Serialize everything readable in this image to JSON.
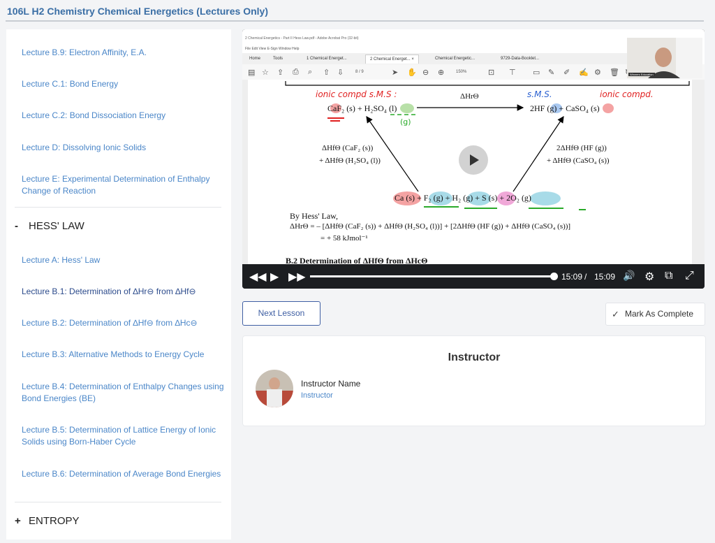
{
  "course": {
    "title": "106L H2 Chemistry Chemical Energetics (Lectures Only)"
  },
  "sidebar": {
    "items_top": [
      {
        "label": "Lecture B.9: Electron Affinity, E.A."
      },
      {
        "label": "Lecture C.1: Bond Energy"
      },
      {
        "label": "Lecture C.2: Bond Dissociation Energy"
      },
      {
        "label": "Lecture D: Dissolving Ionic Solids"
      },
      {
        "label": "Lecture E: Experimental Determination of Enthalpy Change of Reaction"
      }
    ],
    "section_hess": {
      "sign": "-",
      "title": "HESS' LAW"
    },
    "items_hess": [
      {
        "label": "Lecture A: Hess' Law"
      },
      {
        "label": "Lecture B.1: Determination of ∆Hr⊖ from ∆Hf⊖",
        "active": true
      },
      {
        "label": "Lecture B.2: Determination of ∆Hf⊖ from ∆Hc⊖"
      },
      {
        "label": "Lecture B.3: Alternative Methods to Energy Cycle"
      },
      {
        "label": "Lecture B.4: Determination of Enthalpy Changes using Bond Energies (BE)"
      },
      {
        "label": "Lecture B.5: Determination of Lattice Energy of Ionic Solids using Born-Haber Cycle"
      },
      {
        "label": "Lecture B.6: Determination of Average Bond Energies"
      }
    ],
    "section_entropy": {
      "sign": "+",
      "title": "ENTROPY"
    }
  },
  "video": {
    "window_title": "2 Chemical Energetics - Part II Hess Law.pdf - Adobe Acrobat Pro (32-bit)",
    "menu": "File  Edit  View  E-Sign  Window  Help",
    "tabs": [
      "Home",
      "Tools",
      "1 Chemical Energet...",
      "2 Chemical Energet... ×",
      "Chemical Energetic...",
      "9729-Data-Booklet..."
    ],
    "page": "8 / 9",
    "zoom": "150%",
    "webcam_label": "Winners Education",
    "doc": {
      "annot_left": "ionic compd  s.M.S :",
      "annot_right_sms": "s.M.S.",
      "annot_right_ionic": "ionic compd.",
      "arrow_label": "ΔHrΘ",
      "reactants": "CaF₂ (s) + H₂SO₄ (l)",
      "products": "2HF (g) + CaSO₄ (s)",
      "annot_g": "(g)",
      "left_path": [
        "ΔHfΘ (CaF₂ (s))",
        "+ ΔHfΘ (H₂SO₄ (l))"
      ],
      "right_path": [
        "2ΔHfΘ (HF (g))",
        "+ ΔHfΘ (CaSO₄ (s))"
      ],
      "elements": "Ca (s) + F₂ (g) + H₂ (g) + S (s) + 2O₂ (g)",
      "hess_title": "By Hess' Law,",
      "hess_line1": "ΔHrΘ   = – [ΔHfΘ (CaF₂ (s)) + ΔHfΘ (H₂SO₄ (l))] + [2ΔHfΘ (HF (g)) + ΔHfΘ (CaSO₄ (s))]",
      "hess_line2": "= + 58 kJmol⁻¹",
      "next_heading": "B.2 Determination of ΔHfΘ from ΔHcΘ"
    },
    "progress": 1.0,
    "current_time": "15:09",
    "separator": "/",
    "duration": "15:09"
  },
  "actions": {
    "next_lesson": "Next Lesson",
    "mark_complete": "Mark As Complete"
  },
  "instructor": {
    "heading": "Instructor",
    "name": "Instructor Name",
    "role": "Instructor"
  }
}
